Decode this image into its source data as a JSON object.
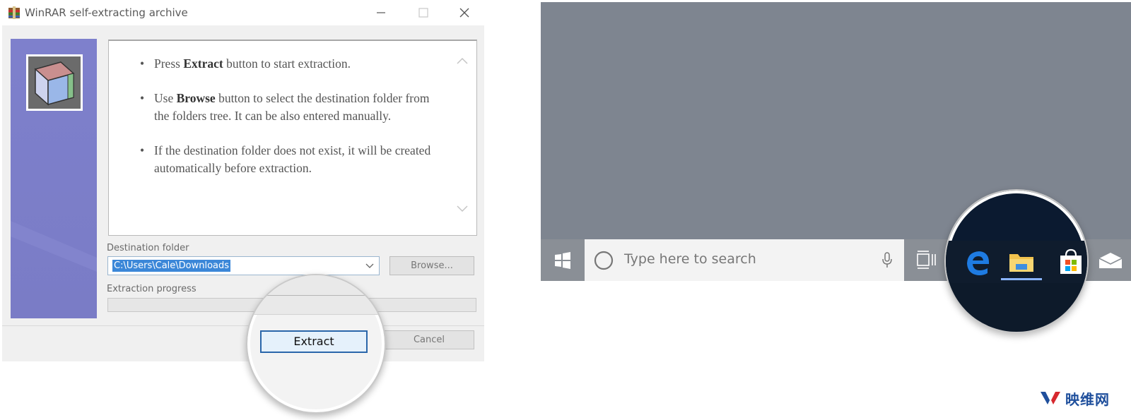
{
  "dialog": {
    "title": "WinRAR self-extracting archive",
    "instructions": [
      {
        "pre": "Press ",
        "bold": "Extract",
        "post": " button to start extraction."
      },
      {
        "pre": "Use ",
        "bold": "Browse",
        "post": " button to select the destination folder from the folders tree. It can be also entered manually."
      },
      {
        "pre": "If the destination folder does not exist, it will be created automatically before extraction.",
        "bold": "",
        "post": ""
      }
    ],
    "destination_label": "Destination folder",
    "destination_value": "C:\\Users\\Cale\\Downloads",
    "browse_label": "Browse...",
    "progress_label": "Extraction progress",
    "progress": 0,
    "extract_label": "Extract",
    "cancel_label": "Cancel"
  },
  "taskbar": {
    "search_placeholder": "Type here to search",
    "pinned_icons": [
      "edge-icon",
      "file-explorer-icon",
      "store-icon"
    ]
  },
  "watermark": {
    "text": "映维网"
  },
  "colors": {
    "banner": "#7e80cc",
    "accent": "#2a66aa",
    "selection": "#3b87d8",
    "desktop": "#7e8590"
  }
}
